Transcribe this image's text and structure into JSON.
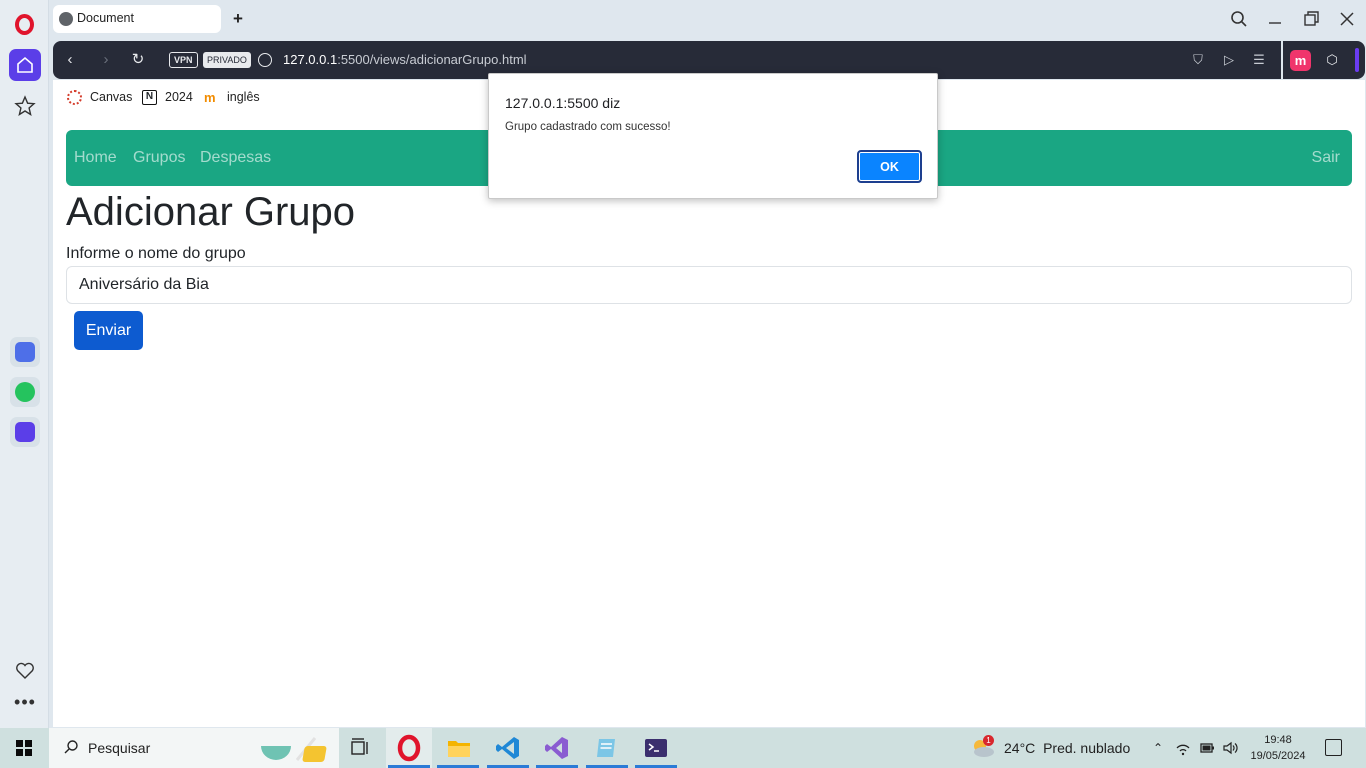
{
  "browser": {
    "tab_title": "Document",
    "vpn_badge": "VPN",
    "private_badge": "PRIVADO",
    "url_host": "127.0.0.1",
    "url_rest": ":5500/views/adicionarGrupo.html",
    "extension_label": "m"
  },
  "bookmarks": [
    {
      "label": "Canvas",
      "icon": "canvas-icon"
    },
    {
      "label": "2024",
      "icon": "notion-icon"
    },
    {
      "label": "inglês",
      "icon": "moodle-icon"
    }
  ],
  "navbar": {
    "links": [
      "Home",
      "Grupos",
      "Despesas"
    ],
    "logout": "Sair"
  },
  "form": {
    "heading": "Adicionar Grupo",
    "label": "Informe o nome do grupo",
    "input_value": "Aniversário da Bia",
    "submit": "Enviar"
  },
  "alert": {
    "title": "127.0.0.1:5500 diz",
    "message": "Grupo cadastrado com sucesso!",
    "ok": "OK"
  },
  "taskbar": {
    "search_placeholder": "Pesquisar",
    "weather_temp": "24°C",
    "weather_desc": "Pred. nublado",
    "weather_badge": "1",
    "time": "19:48",
    "date": "19/05/2024"
  },
  "colors": {
    "navbar": "#1aa683",
    "primary_button": "#0d5bd0",
    "dialog_ok": "#0a84ff",
    "opera_red": "#e0142c",
    "sidebar_home": "#5b3ee8"
  }
}
